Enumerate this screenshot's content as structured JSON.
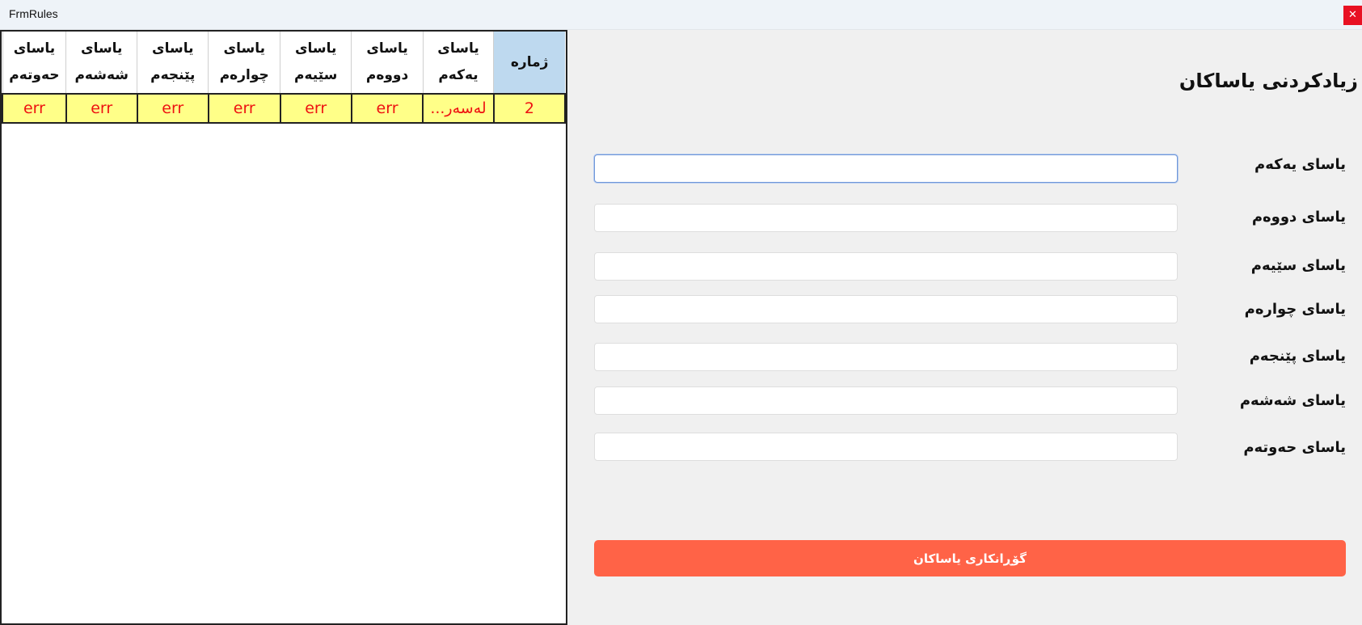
{
  "window": {
    "title": "FrmRules",
    "close_label": "✕"
  },
  "grid": {
    "columns": [
      {
        "key": "num",
        "label": "ژمارە"
      },
      {
        "key": "r1",
        "label": "یاسای یەکەم"
      },
      {
        "key": "r2",
        "label": "یاسای دووەم"
      },
      {
        "key": "r3",
        "label": "یاسای سێیەم"
      },
      {
        "key": "r4",
        "label": "یاسای چوارەم"
      },
      {
        "key": "r5",
        "label": "یاسای پێنجەم"
      },
      {
        "key": "r6",
        "label": "یاسای شەشەم"
      },
      {
        "key": "r7",
        "label": "یاسای حەوتەم"
      }
    ],
    "rows": [
      [
        "2",
        "لەسەر...",
        "err",
        "err",
        "err",
        "err",
        "err",
        "err"
      ]
    ]
  },
  "form": {
    "heading": "زیادکردنی یاساکان",
    "fields": [
      {
        "label": "یاسای یەکەم",
        "value": ""
      },
      {
        "label": "یاسای دووەم",
        "value": ""
      },
      {
        "label": "یاسای سێیەم",
        "value": ""
      },
      {
        "label": "یاسای چوارەم",
        "value": ""
      },
      {
        "label": "یاسای پێنجەم",
        "value": ""
      },
      {
        "label": "یاسای شەشەم",
        "value": ""
      },
      {
        "label": "یاسای حەوتەم",
        "value": ""
      }
    ],
    "submit_label": "گۆڕانکاری یاساکان"
  },
  "colors": {
    "accent": "#ff6347",
    "row_highlight": "#ffff88",
    "header_selected": "#bed9ef",
    "error_text": "#ee1111"
  }
}
